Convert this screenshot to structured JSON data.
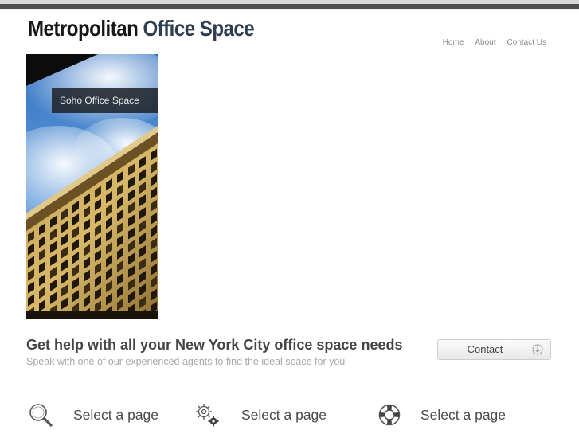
{
  "header": {
    "logo_part1": "Metropolitan",
    "logo_part2": "Office Space",
    "nav": [
      {
        "label": "Home"
      },
      {
        "label": "About"
      },
      {
        "label": "Contact Us"
      }
    ]
  },
  "hero": {
    "caption": "Soho Office Space",
    "image": "building-photo"
  },
  "cta": {
    "heading": "Get help with all your New York City office space needs",
    "subheading": "Speak with one of our experienced agents to find the ideal space for you",
    "button_label": "Contact",
    "button_icon": "arrow-down-circle-icon"
  },
  "features": [
    {
      "label": "Select a page",
      "icon": "magnifier-icon"
    },
    {
      "label": "Select a page",
      "icon": "gears-icon"
    },
    {
      "label": "Select a page",
      "icon": "lifebuoy-icon"
    }
  ],
  "colors": {
    "logo_dark": "#161616",
    "logo_accent": "#2e3d50",
    "nav_text": "#8a8a8a",
    "caption_bg": "#1e2228"
  }
}
